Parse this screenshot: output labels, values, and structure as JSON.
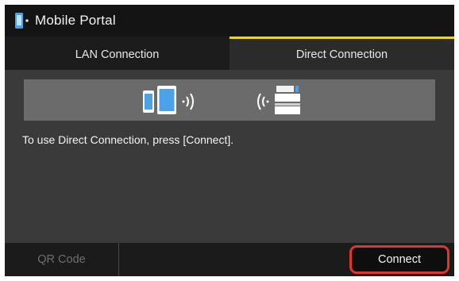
{
  "header": {
    "title": "Mobile Portal",
    "icon": "mobile-portal-icon"
  },
  "tabs": [
    {
      "label": "LAN Connection",
      "active": false
    },
    {
      "label": "Direct Connection",
      "active": true
    }
  ],
  "banner": {
    "icons": [
      "smartphone-icon",
      "tablet-icon",
      "wireless-signal-icon",
      "wireless-signal-icon",
      "printer-icon"
    ]
  },
  "main": {
    "message": "To use Direct Connection, press [Connect]."
  },
  "footer": {
    "qr_label": "QR Code",
    "qr_enabled": false,
    "connect_label": "Connect"
  },
  "colors": {
    "accent_tab": "#e6d23a",
    "device_blue": "#4aa3e8",
    "highlight_ring": "#e0352c",
    "screen_bg": "#3a3a3a"
  }
}
